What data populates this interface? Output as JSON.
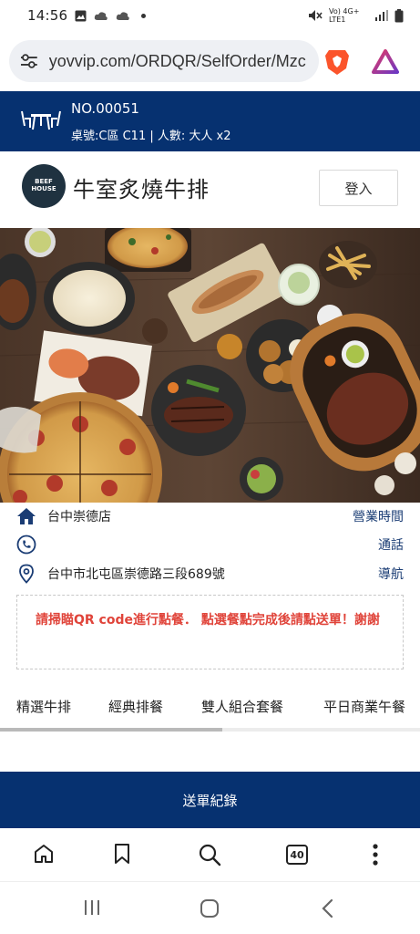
{
  "status": {
    "time": "14:56",
    "network": "Vo) 4G+ LTE1"
  },
  "browser": {
    "url": "yovvip.com/ORDQR/SelfOrder/Mzc",
    "tab_count": "40"
  },
  "order": {
    "number": "NO.00051",
    "info": "桌號:C區 C11 | 人數: 大人 x2"
  },
  "store": {
    "logo_text": "BEEF HOUSE",
    "name": "牛室炙燒牛排",
    "login_label": "登入"
  },
  "info": {
    "branch": "台中崇德店",
    "hours_label": "營業時間",
    "call_label": "通話",
    "address": "台中市北屯區崇德路三段689號",
    "nav_label": "導航"
  },
  "notice": {
    "text": "請掃瞄QR  code進行點餐．   點選餐點完成後請點送單！謝謝"
  },
  "tabs": [
    {
      "label": "精選牛排"
    },
    {
      "label": "經典排餐"
    },
    {
      "label": "雙人組合套餐"
    },
    {
      "label": "平日商業午餐"
    }
  ],
  "tab_scroll_fraction": 0.53,
  "submit": {
    "label": "送單紀錄"
  },
  "colors": {
    "primary": "#063170",
    "notice": "#e0443a",
    "link": "#1a3c74"
  },
  "icons": [
    "settings-sliders-icon",
    "brave-lion-icon",
    "rewards-triangle-icon",
    "table-chairs-icon",
    "home-icon",
    "phone-icon",
    "location-pin-icon",
    "bookmark-icon",
    "search-icon",
    "more-icon",
    "recents-icon",
    "nav-home-icon",
    "back-icon"
  ]
}
